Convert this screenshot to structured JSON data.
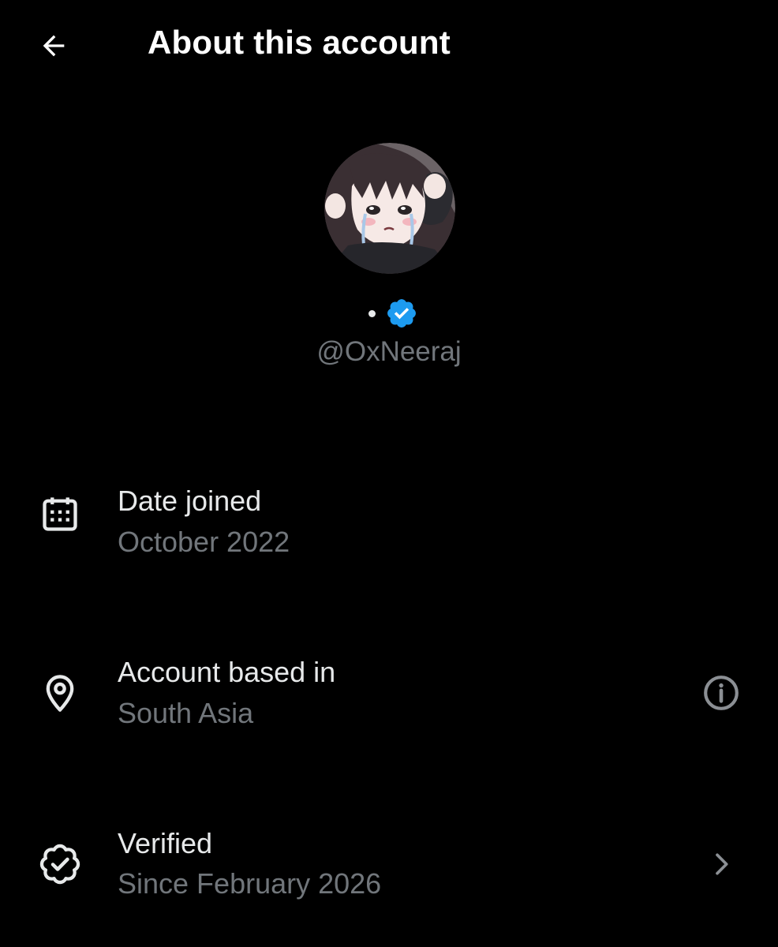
{
  "header": {
    "title": "About this account",
    "back_icon": "back-arrow-icon"
  },
  "profile": {
    "display_name": "",
    "handle": "@OxNeeraj",
    "verified_icon": "verified-badge-icon",
    "badge_color": "#1d9bf0"
  },
  "details": [
    {
      "icon": "calendar-icon",
      "label": "Date joined",
      "value": "October 2022"
    },
    {
      "icon": "location-pin-icon",
      "label": "Account based in",
      "value": "South Asia",
      "trailing_icon": "info-icon"
    },
    {
      "icon": "verified-outline-icon",
      "label": "Verified",
      "value": "Since February 2026",
      "trailing_icon": "chevron-right-icon"
    }
  ],
  "colors": {
    "background": "#000000",
    "primary_text": "#e7e9ea",
    "secondary_text": "#71767b",
    "accent": "#1d9bf0"
  }
}
